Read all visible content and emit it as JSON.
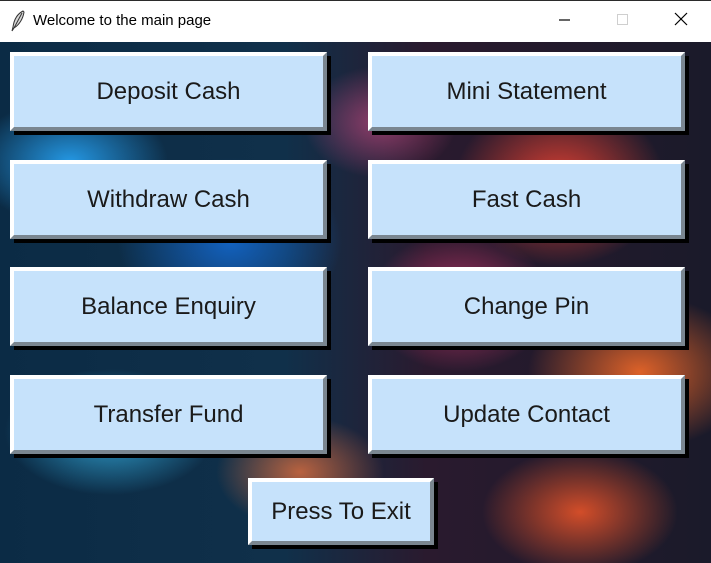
{
  "window": {
    "title": "Welcome to the main page",
    "icon": "feather-icon",
    "controls": {
      "minimize_icon": "minimize-icon",
      "maximize_icon": "maximize-icon",
      "close_icon": "close-icon"
    }
  },
  "buttons": {
    "deposit_cash": "Deposit Cash",
    "mini_statement": "Mini Statement",
    "withdraw_cash": "Withdraw Cash",
    "fast_cash": "Fast Cash",
    "balance_enquiry": "Balance Enquiry",
    "change_pin": "Change Pin",
    "transfer_fund": "Transfer Fund",
    "update_contact": "Update Contact",
    "exit": "Press To Exit"
  },
  "colors": {
    "button_face": "#c6e2fb",
    "button_text": "#1a1a2a",
    "titlebar_bg": "#ffffff"
  }
}
